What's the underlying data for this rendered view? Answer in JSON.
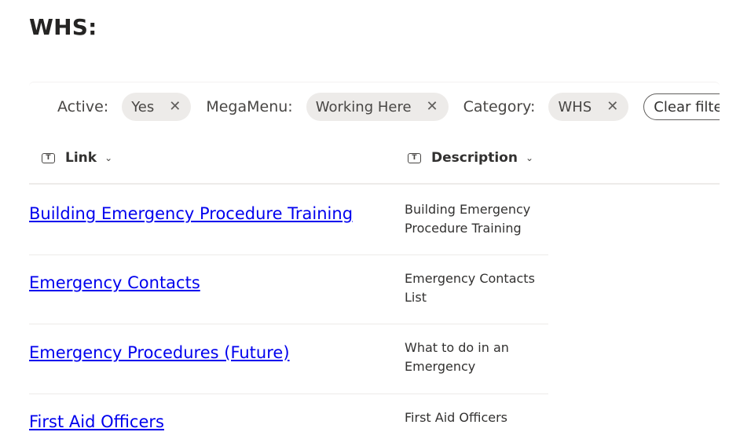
{
  "page": {
    "title": "WHS:"
  },
  "filters": [
    {
      "label": "Active:",
      "value": "Yes",
      "close_icon": "dismiss-icon"
    },
    {
      "label": "MegaMenu:",
      "value": "Working Here",
      "close_icon": "dismiss-icon"
    },
    {
      "label": "Category:",
      "value": "WHS",
      "close_icon": "dismiss-icon"
    }
  ],
  "clear_filter_label": "Clear filter",
  "dismiss_glyph": "✕",
  "columns": [
    {
      "label": "Link",
      "icon": "text-type-icon",
      "icon_glyph": "T",
      "chevron": "⌄"
    },
    {
      "label": "Description",
      "icon": "text-type-icon",
      "icon_glyph": "T",
      "chevron": "⌄"
    }
  ],
  "rows": [
    {
      "link": "Building Emergency Procedure Training",
      "description": "Building Emergency Procedure Training"
    },
    {
      "link": "Emergency Contacts",
      "description": "Emergency Contacts List"
    },
    {
      "link": "Emergency Procedures (Future)",
      "description": "What to do in an Emergency"
    },
    {
      "link": "First Aid Officers",
      "description": "First Aid Officers"
    }
  ],
  "colors": {
    "link": "#0000ee",
    "chip_bg": "#edebe9",
    "divider": "#edebe9"
  }
}
